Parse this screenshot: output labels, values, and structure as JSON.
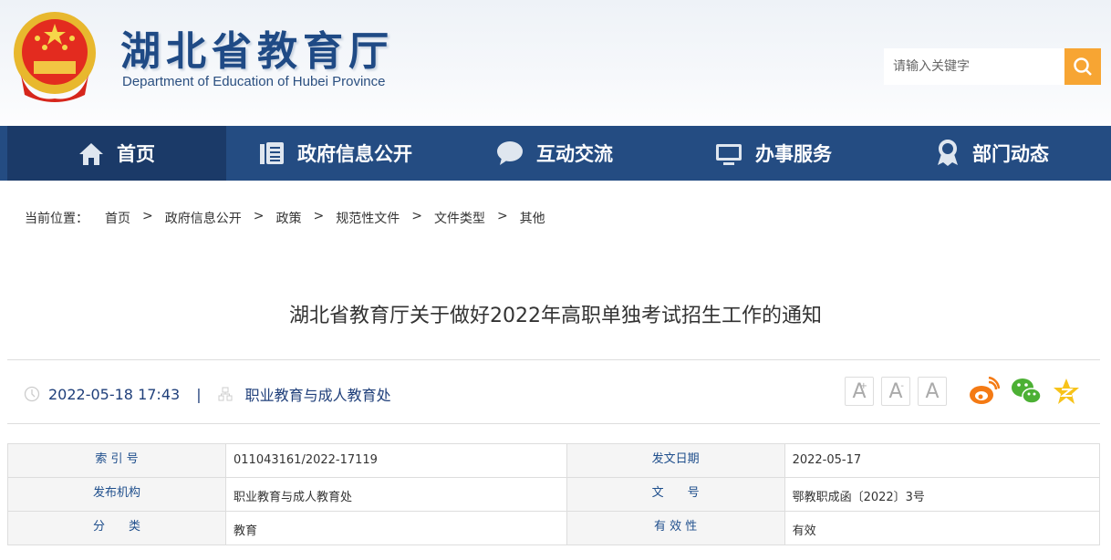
{
  "header": {
    "title": "湖北省教育厅",
    "subtitle": "Department of Education of Hubei Province",
    "search_placeholder": "请输入关键字"
  },
  "nav": [
    {
      "label": "首页",
      "icon": "home-icon"
    },
    {
      "label": "政府信息公开",
      "icon": "document-icon"
    },
    {
      "label": "互动交流",
      "icon": "chat-icon"
    },
    {
      "label": "办事服务",
      "icon": "monitor-icon"
    },
    {
      "label": "部门动态",
      "icon": "award-icon"
    }
  ],
  "breadcrumb": {
    "prefix": "当前位置：",
    "items": [
      "首页",
      "政府信息公开",
      "政策",
      "规范性文件",
      "文件类型",
      "其他"
    ],
    "sep": ">"
  },
  "article": {
    "title": "湖北省教育厅关于做好2022年高职单独考试招生工作的通知",
    "datetime": "2022-05-18 17:43",
    "divider": "|",
    "department": "职业教育与成人教育处"
  },
  "font_buttons": [
    "A",
    "A",
    "A"
  ],
  "font_button_marks": [
    "+",
    "-"
  ],
  "info_table": [
    [
      {
        "k": "索 引 号",
        "v": "011043161/2022-17119"
      },
      {
        "k": "发文日期",
        "v": "2022-05-17"
      }
    ],
    [
      {
        "k": "发布机构",
        "v": "职业教育与成人教育处"
      },
      {
        "k": "文　　号",
        "v": "鄂教职成函〔2022〕3号"
      }
    ],
    [
      {
        "k": "分　　类",
        "v": "教育"
      },
      {
        "k": "有 效 性",
        "v": "有效"
      }
    ]
  ],
  "colors": {
    "nav": "#244c82",
    "nav_active": "#1b3a68",
    "accent": "#f7a533"
  }
}
